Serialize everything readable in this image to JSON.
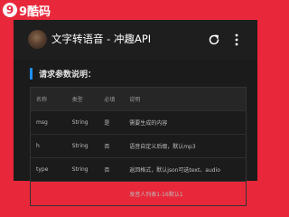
{
  "brand": {
    "logo_char": "9",
    "name": "9酷码"
  },
  "app": {
    "title": "文字转语音 - 冲趣API"
  },
  "icons": {
    "refresh": "refresh-icon",
    "more": "more-vertical-icon",
    "avatar": "avatar-image"
  },
  "section": {
    "title": "请求参数说明："
  },
  "table": {
    "headers": [
      "名称",
      "类型",
      "必填",
      "说明"
    ],
    "rows": [
      [
        "msg",
        "String",
        "是",
        "需要生成的内容"
      ],
      [
        "h",
        "String",
        "否",
        "语音自定义后缀，默认mp3"
      ],
      [
        "type",
        "String",
        "否",
        "返回格式，默认json可选text、audio"
      ],
      [
        "",
        "",
        "",
        "发音人列表1-16默认1"
      ]
    ]
  },
  "colors": {
    "brand_red": "#e8283a",
    "card_bg": "#1b1b1b",
    "accent": "#1e90ff"
  }
}
